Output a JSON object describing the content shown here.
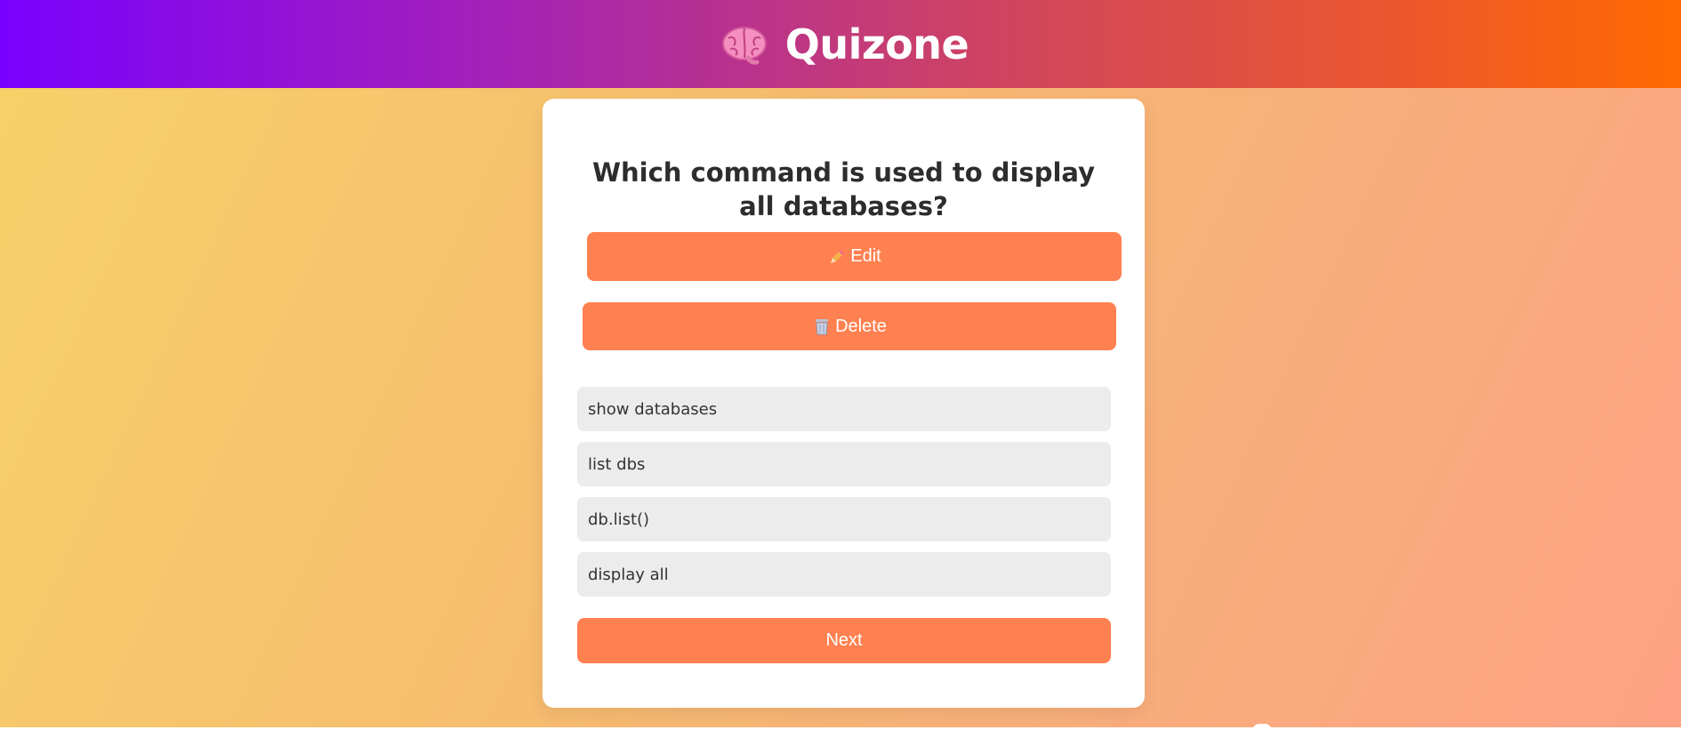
{
  "header": {
    "brand_icon": "brain-icon",
    "title": "Quizone",
    "gradient": [
      "#7a00ff",
      "#ff6a00"
    ]
  },
  "quiz": {
    "question": "Which command is used to display all databases?",
    "edit_icon": "pencil-icon",
    "edit_label": "Edit",
    "delete_icon": "trash-icon",
    "delete_label": "Delete",
    "options": [
      "show databases",
      "list dbs",
      "db.list()",
      "display all"
    ],
    "next_label": "Next"
  },
  "colors": {
    "accent": "#ff8050",
    "option_bg": "#ececec",
    "text": "#2d2d2d"
  }
}
